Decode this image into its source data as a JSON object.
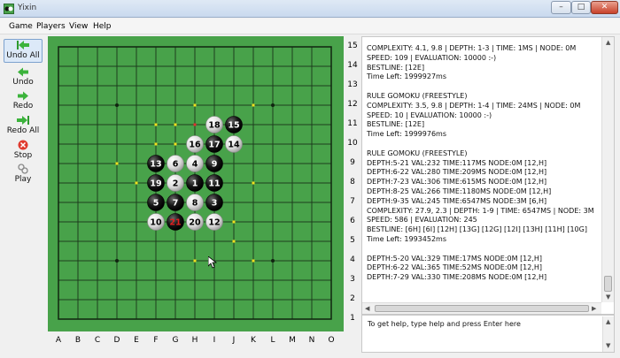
{
  "window": {
    "title": "Yixin",
    "min_label": "–",
    "max_label": "□",
    "close_label": "✕"
  },
  "menu": {
    "items": [
      "Game",
      "Players",
      "View",
      "Help"
    ]
  },
  "toolbar": {
    "undo_all": "Undo All",
    "undo": "Undo",
    "redo": "Redo",
    "redo_all": "Redo All",
    "stop": "Stop",
    "play": "Play"
  },
  "board": {
    "size": 15,
    "columns": [
      "A",
      "B",
      "C",
      "D",
      "E",
      "F",
      "G",
      "H",
      "I",
      "J",
      "K",
      "L",
      "M",
      "N",
      "O"
    ],
    "rows": [
      "15",
      "14",
      "13",
      "12",
      "11",
      "10",
      "9",
      "8",
      "7",
      "6",
      "5",
      "4",
      "3",
      "2",
      "1"
    ],
    "background_color": "#48a24a",
    "stones": [
      {
        "move": 1,
        "col": "H",
        "row": 8,
        "color": "black"
      },
      {
        "move": 2,
        "col": "G",
        "row": 8,
        "color": "white"
      },
      {
        "move": 3,
        "col": "I",
        "row": 7,
        "color": "black"
      },
      {
        "move": 4,
        "col": "H",
        "row": 9,
        "color": "white"
      },
      {
        "move": 5,
        "col": "F",
        "row": 7,
        "color": "black"
      },
      {
        "move": 6,
        "col": "G",
        "row": 9,
        "color": "white"
      },
      {
        "move": 7,
        "col": "G",
        "row": 7,
        "color": "black"
      },
      {
        "move": 8,
        "col": "H",
        "row": 7,
        "color": "white"
      },
      {
        "move": 9,
        "col": "I",
        "row": 9,
        "color": "black"
      },
      {
        "move": 10,
        "col": "F",
        "row": 6,
        "color": "white"
      },
      {
        "move": 11,
        "col": "I",
        "row": 8,
        "color": "black"
      },
      {
        "move": 12,
        "col": "I",
        "row": 6,
        "color": "white"
      },
      {
        "move": 13,
        "col": "F",
        "row": 9,
        "color": "black"
      },
      {
        "move": 14,
        "col": "J",
        "row": 10,
        "color": "white"
      },
      {
        "move": 15,
        "col": "J",
        "row": 11,
        "color": "black"
      },
      {
        "move": 16,
        "col": "H",
        "row": 10,
        "color": "white"
      },
      {
        "move": 17,
        "col": "I",
        "row": 10,
        "color": "black"
      },
      {
        "move": 18,
        "col": "I",
        "row": 11,
        "color": "white"
      },
      {
        "move": 19,
        "col": "F",
        "row": 8,
        "color": "black"
      },
      {
        "move": 20,
        "col": "H",
        "row": 6,
        "color": "white"
      },
      {
        "move": 21,
        "col": "G",
        "row": 6,
        "color": "black",
        "last": true
      }
    ],
    "last_move_color": "#e02020",
    "hints": [
      {
        "col": "H",
        "row": 12,
        "color": "#f0e020"
      },
      {
        "col": "K",
        "row": 12,
        "color": "#f0e020"
      },
      {
        "col": "H",
        "row": 11,
        "color": "#f0e020"
      },
      {
        "col": "F",
        "row": 10,
        "color": "#f0e020"
      },
      {
        "col": "G",
        "row": 11,
        "color": "#f0e020"
      },
      {
        "col": "G",
        "row": 10,
        "color": "#f0e020"
      },
      {
        "col": "E",
        "row": 8,
        "color": "#f0e020"
      },
      {
        "col": "K",
        "row": 8,
        "color": "#f0e020"
      },
      {
        "col": "J",
        "row": 6,
        "color": "#f0e020"
      },
      {
        "col": "J",
        "row": 5,
        "color": "#f0e020"
      },
      {
        "col": "H",
        "row": 4,
        "color": "#f0e020"
      },
      {
        "col": "K",
        "row": 4,
        "color": "#f0e020"
      },
      {
        "col": "F",
        "row": 11,
        "color": "#f0e020"
      },
      {
        "col": "D",
        "row": 9,
        "color": "#f0e020"
      },
      {
        "col": "G",
        "row": 10,
        "color": "#f0e020"
      }
    ],
    "hint_red": {
      "col": "H",
      "row": 11,
      "color": "#e03030"
    },
    "star_points": [
      {
        "col": "D",
        "row": 12
      },
      {
        "col": "L",
        "row": 12
      },
      {
        "col": "H",
        "row": 8
      },
      {
        "col": "D",
        "row": 4
      },
      {
        "col": "L",
        "row": 4
      }
    ]
  },
  "log": {
    "lines": [
      "COMPLEXITY: 4.1, 9.8 | DEPTH: 1-3 | TIME: 1MS | NODE: 0M",
      "SPEED: 109 | EVALUATION: 10000 :-)",
      "BESTLINE: [12E]",
      "Time Left: 1999927ms",
      "",
      "RULE GOMOKU (FREESTYLE)",
      "COMPLEXITY: 3.5, 9.8 | DEPTH: 1-4 | TIME: 24MS | NODE: 0M",
      "SPEED: 10 | EVALUATION: 10000 :-)",
      "BESTLINE: [12E]",
      "Time Left: 1999976ms",
      "",
      "RULE GOMOKU (FREESTYLE)",
      "DEPTH:5-21 VAL:232 TIME:117MS NODE:0M [12,H]",
      "DEPTH:6-22 VAL:280 TIME:209MS NODE:0M [12,H]",
      "DEPTH:7-23 VAL:306 TIME:615MS NODE:0M [12,H]",
      "DEPTH:8-25 VAL:266 TIME:1180MS NODE:0M [12,H]",
      "DEPTH:9-35 VAL:245 TIME:6547MS NODE:3M [6,H]",
      "COMPLEXITY: 27.9, 2.3 | DEPTH: 1-9 | TIME: 6547MS | NODE: 3M",
      "SPEED: 586 | EVALUATION: 245",
      "BESTLINE: [6H] [6I] [12H] [13G] [12G] [12I] [13H] [11H] [10G]",
      "Time Left: 1993452ms",
      "",
      "DEPTH:5-20 VAL:329 TIME:17MS NODE:0M [12,H]",
      "DEPTH:6-22 VAL:365 TIME:52MS NODE:0M [12,H]",
      "DEPTH:7-29 VAL:330 TIME:208MS NODE:0M [12,H]"
    ]
  },
  "command": {
    "text": "To get help, type help and press Enter here"
  },
  "colors": {
    "board": "#48a24a",
    "black_stone": "#111111",
    "white_stone": "#e8e8e8"
  }
}
